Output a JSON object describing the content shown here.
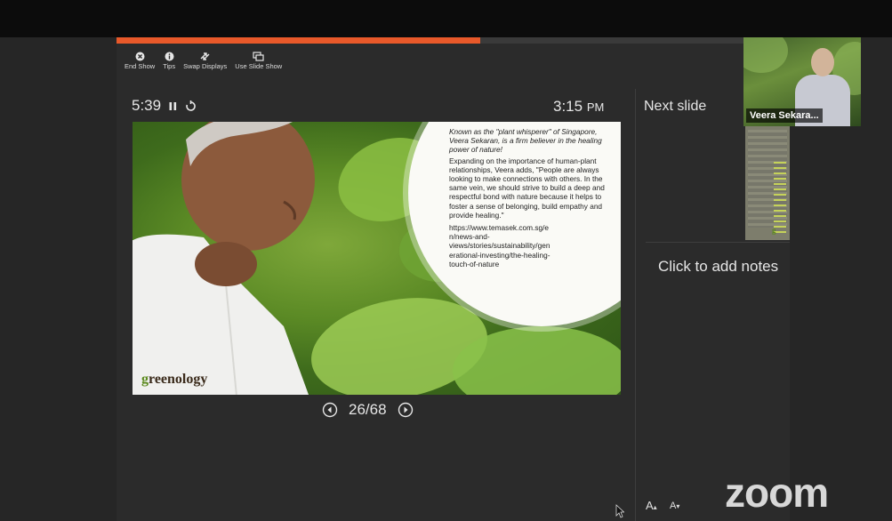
{
  "progress": {
    "fraction": 0.58,
    "accent": "#e8592a"
  },
  "toolbar": {
    "items": [
      {
        "label": "End Show",
        "icon": "close-circle-icon"
      },
      {
        "label": "Tips",
        "icon": "info-circle-icon"
      },
      {
        "label": "Swap Displays",
        "icon": "swap-arrows-icon"
      },
      {
        "label": "Use Slide Show",
        "icon": "slide-show-icon"
      }
    ]
  },
  "timer": {
    "elapsed": "5:39"
  },
  "clock": {
    "time": "3:15",
    "ampm": "PM"
  },
  "slide": {
    "intro": "Known as the \"plant whisperer\" of Singapore, Veera Sekaran, is a firm believer in the healing power of nature!",
    "body": "Expanding on the importance of human-plant relationships, Veera adds, \"People are always looking to make connections with others. In the same vein, we should strive to build a deep and respectful bond with nature because it helps to foster a sense of belonging, build empathy and provide healing.\"",
    "url_lines": [
      "https://www.temasek.com.sg/e",
      "n/news-and-",
      "views/stories/sustainability/gen",
      "erational-investing/the-healing-",
      "touch-of-nature"
    ],
    "logo_g": "g",
    "logo_rest": "reenology"
  },
  "pager": {
    "text": "26/68"
  },
  "next_slide": {
    "label": "Next slide"
  },
  "notes": {
    "placeholder": "Click to add notes"
  },
  "font_controls": {
    "increase": "A",
    "decrease": "A"
  },
  "video": {
    "name": "Veera Sekara..."
  },
  "branding": {
    "zoom": "zoom"
  }
}
